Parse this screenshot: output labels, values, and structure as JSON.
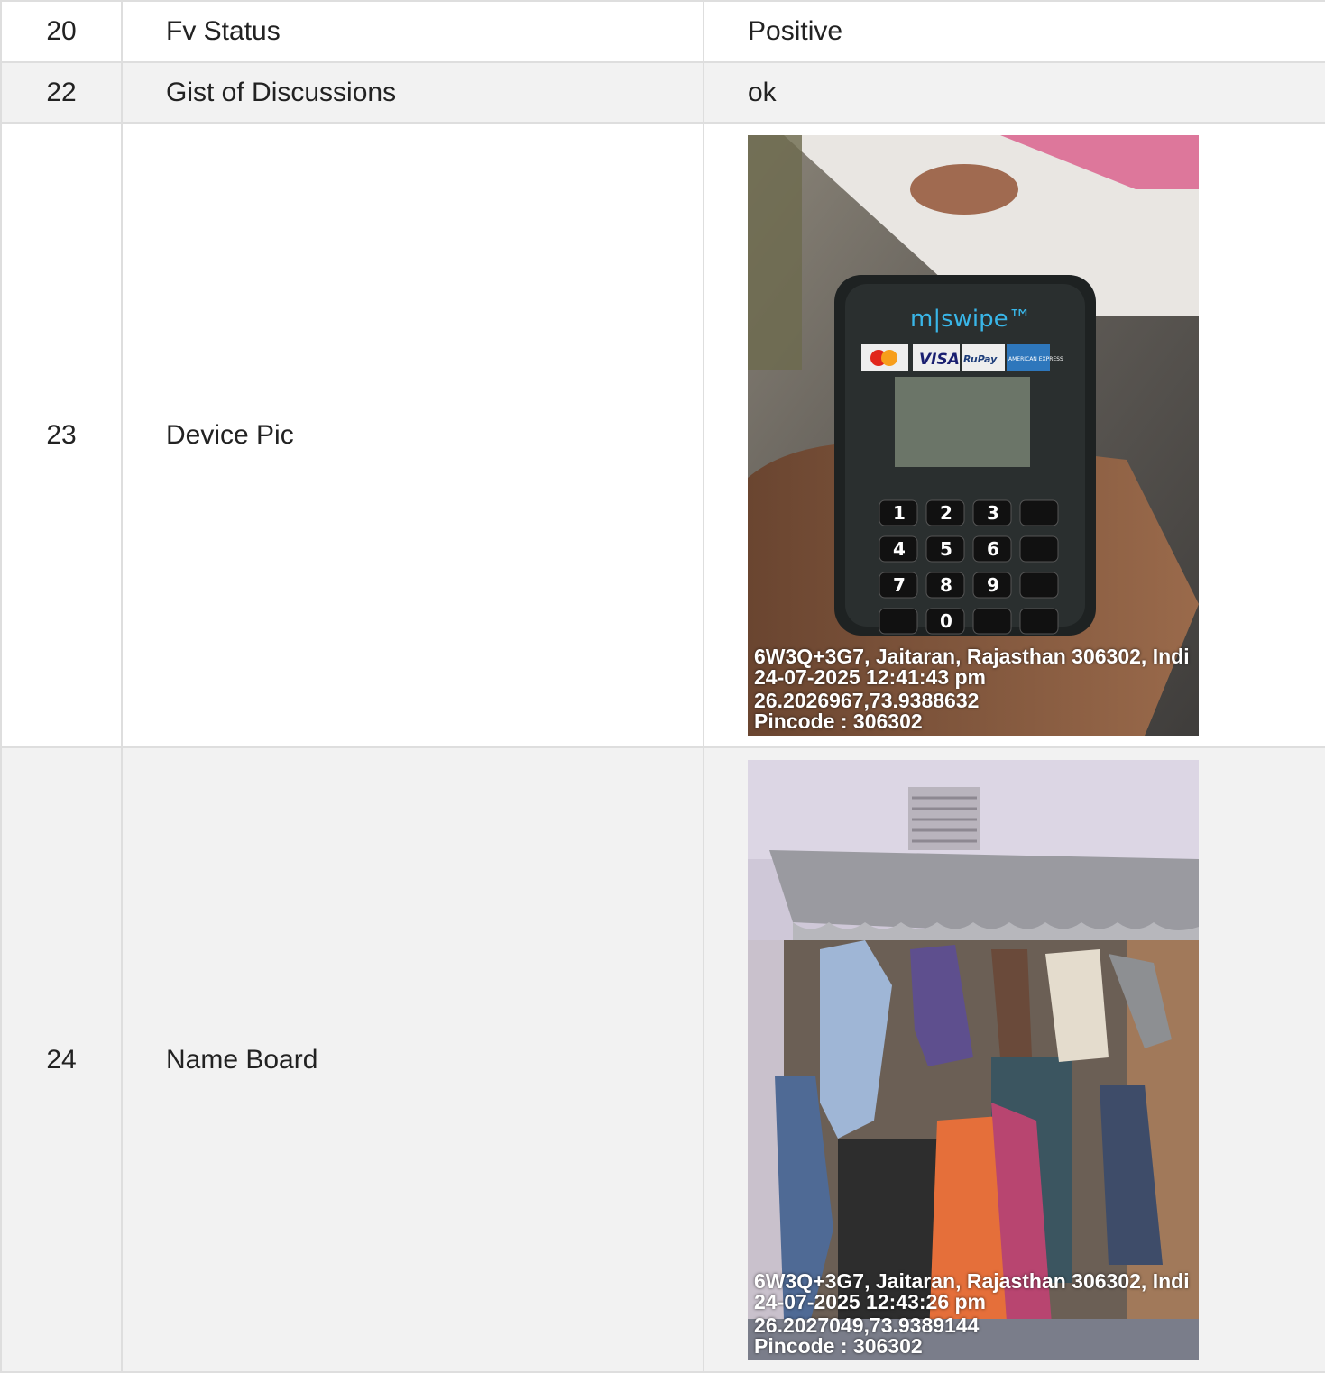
{
  "rows": [
    {
      "num": "20",
      "label": "Fv Status",
      "value": "Positive"
    },
    {
      "num": "22",
      "label": "Gist of Discussions",
      "value": "ok"
    },
    {
      "num": "23",
      "label": "Device Pic",
      "photo": {
        "device_brand": "m|swipe™",
        "card_logos": [
          "VISA",
          "RuPay",
          "AMERICAN EXPRESS"
        ],
        "keypad": [
          "1",
          "2",
          "3",
          "4",
          "5",
          "6",
          "7",
          "8",
          "9",
          "0"
        ],
        "stamp": {
          "address": "6W3Q+3G7, Jaitaran, Rajasthan 306302, Indi",
          "datetime": "24-07-2025 12:41:43 pm",
          "coords": "26.2026967,73.9388632",
          "pincode": "Pincode : 306302"
        }
      }
    },
    {
      "num": "24",
      "label": "Name Board",
      "photo": {
        "stamp": {
          "address": "6W3Q+3G7, Jaitaran, Rajasthan 306302, Indi",
          "datetime": "24-07-2025 12:43:26 pm",
          "coords": "26.2027049,73.9389144",
          "pincode": "Pincode : 306302"
        }
      }
    }
  ]
}
